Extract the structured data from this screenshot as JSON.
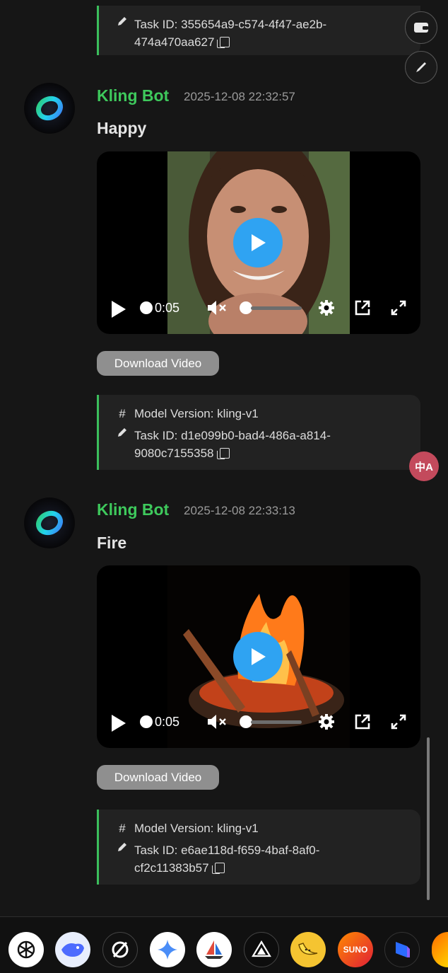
{
  "top_card": {
    "task_id_line1": "Task ID: 355654a9-c574-4f47-ae2b-",
    "task_id_line2": "474a470aa627"
  },
  "messages": [
    {
      "bot_name": "Kling Bot",
      "timestamp": "2025-12-08 22:32:57",
      "prompt": "Happy",
      "video_time": "0:05",
      "download_label": "Download Video",
      "model_version": "Model Version: kling-v1",
      "task_id_line1": "Task ID: d1e099b0-bad4-486a-a814-",
      "task_id_line2": "9080c7155358"
    },
    {
      "bot_name": "Kling Bot",
      "timestamp": "2025-12-08 22:33:13",
      "prompt": "Fire",
      "video_time": "0:05",
      "download_label": "Download Video",
      "model_version": "Model Version: kling-v1",
      "task_id_line1": "Task ID: e6ae118d-f659-4baf-8af0-",
      "task_id_line2": "cf2c11383b57"
    }
  ],
  "translate_button": {
    "label": "中A"
  },
  "dock": {
    "apps": [
      "openai-icon",
      "deepseek-icon",
      "perplexity-icon",
      "gemini-icon",
      "sailboat-icon",
      "black-forest-labs-icon",
      "banana-icon",
      "suno-icon",
      "kling-icon",
      "partial-app-icon"
    ],
    "suno_label": "SUNO"
  },
  "colors": {
    "accent_green": "#3ec95c",
    "play_blue": "#2fa3f2",
    "background": "#161616",
    "card": "#222222"
  }
}
